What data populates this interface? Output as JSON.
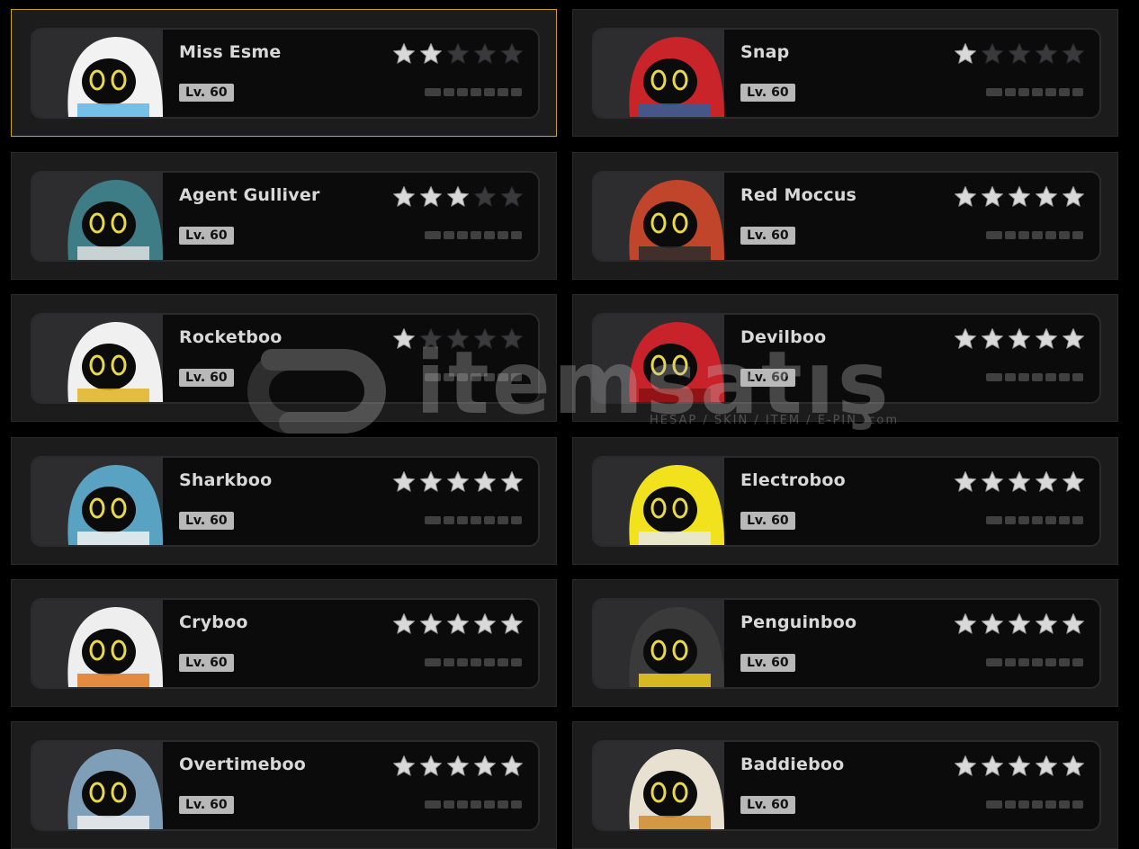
{
  "watermark": {
    "brand": "itemsatış",
    "tagline": "HESAP / SKIN / ITEM / E-PIN .com"
  },
  "colors": {
    "selected_border": "#c9a227",
    "star_on": "#d9d9d9",
    "star_off": "#3a3a3c"
  },
  "characters": [
    {
      "name": "Miss Esme",
      "level": "Lv. 60",
      "stars": 2,
      "selected": true,
      "avatar": "rabbit-ears-blue-bow",
      "avatar_color": "#f2f2f2",
      "accent": "#5fb7e8"
    },
    {
      "name": "Snap",
      "level": "Lv. 60",
      "stars": 1,
      "selected": false,
      "avatar": "red-cap-jacket",
      "avatar_color": "#c8242a",
      "accent": "#2f5f9a"
    },
    {
      "name": "Agent Gulliver",
      "level": "Lv. 60",
      "stars": 3,
      "selected": false,
      "avatar": "teal-cap-agent",
      "avatar_color": "#3f7d86",
      "accent": "#e0e0e0"
    },
    {
      "name": "Red Moccus",
      "level": "Lv. 60",
      "stars": 5,
      "selected": false,
      "avatar": "red-pig-leather",
      "avatar_color": "#c0452a",
      "accent": "#2c2c2c"
    },
    {
      "name": "Rocketboo",
      "level": "Lv. 60",
      "stars": 1,
      "selected": false,
      "avatar": "aviator-goggles",
      "avatar_color": "#f0f0f0",
      "accent": "#e0b422"
    },
    {
      "name": "Devilboo",
      "level": "Lv. 60",
      "stars": 5,
      "selected": false,
      "avatar": "red-devil-hood",
      "avatar_color": "#c8222a",
      "accent": "#8a1010"
    },
    {
      "name": "Sharkboo",
      "level": "Lv. 60",
      "stars": 5,
      "selected": false,
      "avatar": "blue-shark-hood",
      "avatar_color": "#5aa2c2",
      "accent": "#f2f2f2"
    },
    {
      "name": "Electroboo",
      "level": "Lv. 60",
      "stars": 5,
      "selected": false,
      "avatar": "yellow-diver",
      "avatar_color": "#f2e21e",
      "accent": "#e8e8e8"
    },
    {
      "name": "Cryboo",
      "level": "Lv. 60",
      "stars": 5,
      "selected": false,
      "avatar": "white-bunny-glasses",
      "avatar_color": "#eeeeee",
      "accent": "#e07a22"
    },
    {
      "name": "Penguinboo",
      "level": "Lv. 60",
      "stars": 5,
      "selected": false,
      "avatar": "penguin-hood",
      "avatar_color": "#3a3a3a",
      "accent": "#f2cf1e"
    },
    {
      "name": "Overtimeboo",
      "level": "Lv. 60",
      "stars": 5,
      "selected": false,
      "avatar": "grey-bunny",
      "avatar_color": "#7f9fb8",
      "accent": "#eeeeee"
    },
    {
      "name": "Baddieboo",
      "level": "Lv. 60",
      "stars": 5,
      "selected": false,
      "avatar": "white-helmet",
      "avatar_color": "#e8e0d0",
      "accent": "#d08a2a"
    }
  ]
}
